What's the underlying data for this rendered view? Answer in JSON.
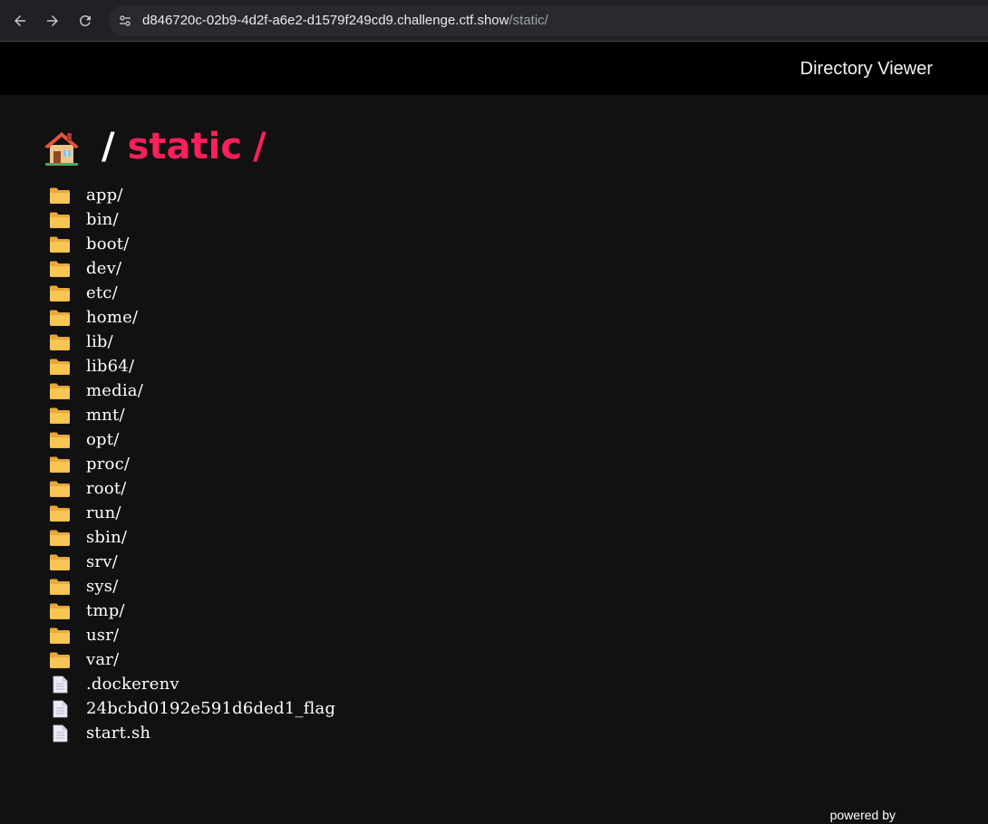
{
  "browser": {
    "url_host": "d846720c-02b9-4d2f-a6e2-d1579f249cd9.challenge.ctf.show",
    "url_path": "/static/",
    "back_icon": "arrow-left-icon",
    "forward_icon": "arrow-right-icon",
    "reload_icon": "reload-icon",
    "site_info_icon": "tune-icon"
  },
  "header": {
    "title": "Directory Viewer"
  },
  "breadcrumb": {
    "home_icon": "house-icon",
    "separator": "/",
    "current": "static",
    "trailing": "/"
  },
  "entries": [
    {
      "name": "app/",
      "type": "folder"
    },
    {
      "name": "bin/",
      "type": "folder"
    },
    {
      "name": "boot/",
      "type": "folder"
    },
    {
      "name": "dev/",
      "type": "folder"
    },
    {
      "name": "etc/",
      "type": "folder"
    },
    {
      "name": "home/",
      "type": "folder"
    },
    {
      "name": "lib/",
      "type": "folder"
    },
    {
      "name": "lib64/",
      "type": "folder"
    },
    {
      "name": "media/",
      "type": "folder"
    },
    {
      "name": "mnt/",
      "type": "folder"
    },
    {
      "name": "opt/",
      "type": "folder"
    },
    {
      "name": "proc/",
      "type": "folder"
    },
    {
      "name": "root/",
      "type": "folder"
    },
    {
      "name": "run/",
      "type": "folder"
    },
    {
      "name": "sbin/",
      "type": "folder"
    },
    {
      "name": "srv/",
      "type": "folder"
    },
    {
      "name": "sys/",
      "type": "folder"
    },
    {
      "name": "tmp/",
      "type": "folder"
    },
    {
      "name": "usr/",
      "type": "folder"
    },
    {
      "name": "var/",
      "type": "folder"
    },
    {
      "name": ".dockerenv",
      "type": "file"
    },
    {
      "name": "24bcbd0192e591d6ded1_flag",
      "type": "file"
    },
    {
      "name": "start.sh",
      "type": "file"
    }
  ],
  "footer": {
    "text": "powered by"
  },
  "colors": {
    "accent": "#ff1f5a",
    "folder": "#f6c34a",
    "background": "#111112"
  }
}
